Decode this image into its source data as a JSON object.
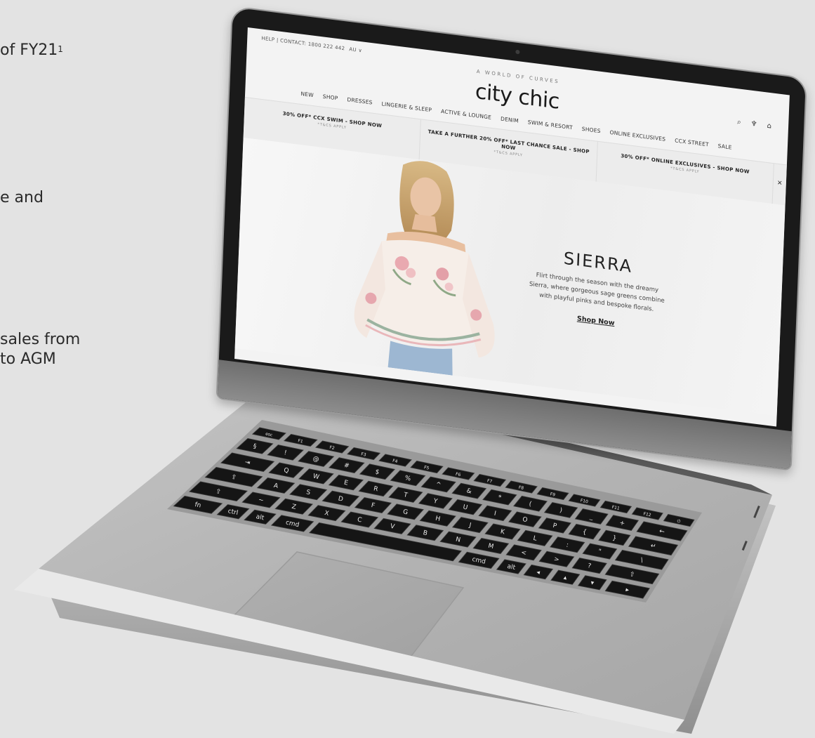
{
  "side_text": {
    "line1": "of FY21",
    "line1_sup": "1",
    "line2": "e and",
    "line3a": "sales from",
    "line3b": "to AGM"
  },
  "website": {
    "top_bar": {
      "help": "HELP | CONTACT: 1800 222 442",
      "region": "AU ∨"
    },
    "tagline": "A WORLD OF CURVES",
    "logo": "city chic",
    "nav": [
      "NEW",
      "SHOP",
      "DRESSES",
      "LINGERIE & SLEEP",
      "ACTIVE & LOUNGE",
      "DENIM",
      "SWIM & RESORT",
      "SHOES",
      "ONLINE EXCLUSIVES",
      "CCX STREET",
      "SALE"
    ],
    "promos": [
      {
        "text": "30% OFF* CCX SWIM - SHOP NOW",
        "note": "*T&CS APPLY"
      },
      {
        "text": "TAKE A FURTHER 20% OFF* LAST CHANCE SALE - SHOP NOW",
        "note": "*T&CS APPLY"
      },
      {
        "text": "30% OFF* ONLINE EXCLUSIVES - SHOP NOW",
        "note": "*T&CS APPLY"
      }
    ],
    "hero": {
      "title": "SIERRA",
      "description": "Flirt through the season with the dreamy Sierra, where gorgeous sage greens combine with playful pinks and bespoke florals.",
      "cta": "Shop Now"
    }
  },
  "keyboard": {
    "row1": [
      "esc",
      "F1",
      "F2",
      "F3",
      "F4",
      "F5",
      "F6",
      "F7",
      "F8",
      "F9",
      "F10",
      "F11",
      "F12",
      "⏻"
    ],
    "row2": [
      "§",
      "!",
      "@",
      "#",
      "$",
      "%",
      "^",
      "&",
      "*",
      "(",
      ")",
      "_",
      "+",
      "←"
    ],
    "row3": [
      "⇥",
      "Q",
      "W",
      "E",
      "R",
      "T",
      "Y",
      "U",
      "I",
      "O",
      "P",
      "{",
      "}",
      "↵"
    ],
    "row4": [
      "⇪",
      "A",
      "S",
      "D",
      "F",
      "G",
      "H",
      "J",
      "K",
      "L",
      ":",
      "\"",
      "\\"
    ],
    "row5": [
      "⇧",
      "~",
      "Z",
      "X",
      "C",
      "V",
      "B",
      "N",
      "M",
      "<",
      ">",
      "?",
      "⇧"
    ],
    "row6": [
      "fn",
      "ctrl",
      "alt",
      "cmd",
      "",
      "cmd",
      "alt",
      "◂",
      "▴",
      "▾",
      "▸"
    ]
  },
  "colors": {
    "background": "#e3e3e3",
    "aluminium": "#b9b9b9",
    "bezel": "#1a1a1a",
    "key": "#151515"
  }
}
